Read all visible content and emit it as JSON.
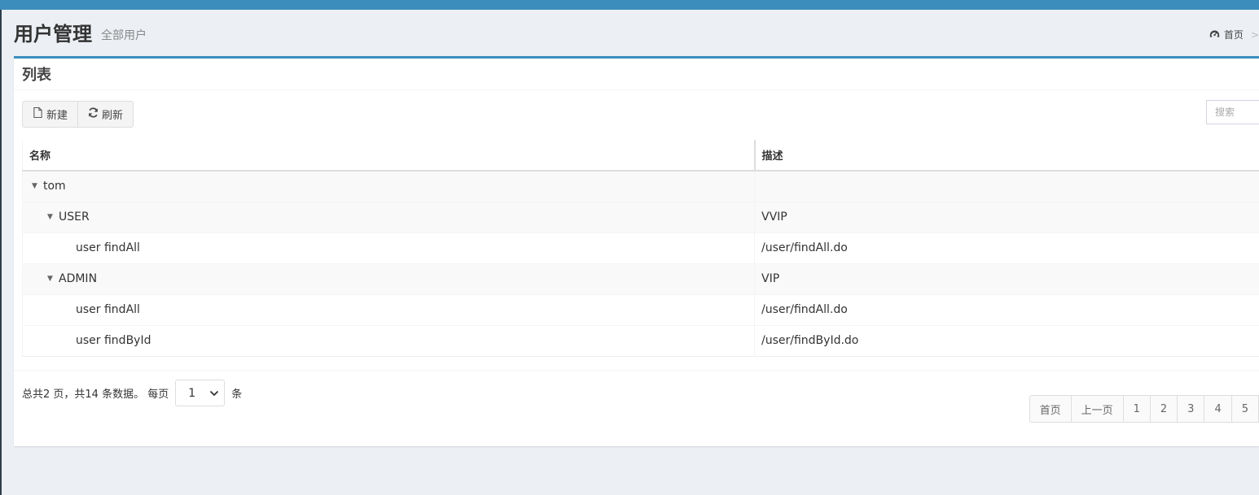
{
  "header": {
    "title": "用户管理",
    "subtitle": "全部用户",
    "breadcrumb": {
      "home": "首页",
      "separator": ">"
    }
  },
  "box": {
    "title": "列表"
  },
  "toolbar": {
    "new_label": "新建",
    "refresh_label": "刷新"
  },
  "search": {
    "placeholder": "搜索"
  },
  "table": {
    "columns": [
      "名称",
      "描述"
    ],
    "rows": [
      {
        "name": "tom",
        "desc": ""
      },
      {
        "name": "USER",
        "desc": "VVIP"
      },
      {
        "name": "user findAll",
        "desc": "/user/findAll.do"
      },
      {
        "name": "ADMIN",
        "desc": "VIP"
      },
      {
        "name": "user findAll",
        "desc": "/user/findAll.do"
      },
      {
        "name": "user findById",
        "desc": "/user/findById.do"
      }
    ]
  },
  "pager": {
    "info_text": "总共2 页，共14 条数据。 每页",
    "page_size": "1",
    "unit": "条",
    "first": "首页",
    "prev": "上一页",
    "pages": [
      "1",
      "2",
      "3",
      "4",
      "5"
    ]
  },
  "icons": {
    "breadcrumb": "dashboard-icon",
    "new": "file-icon",
    "refresh": "refresh-icon",
    "expand": "caret-down-icon"
  },
  "colors": {
    "accent": "#3c8dbc",
    "background": "#ecf0f5"
  }
}
